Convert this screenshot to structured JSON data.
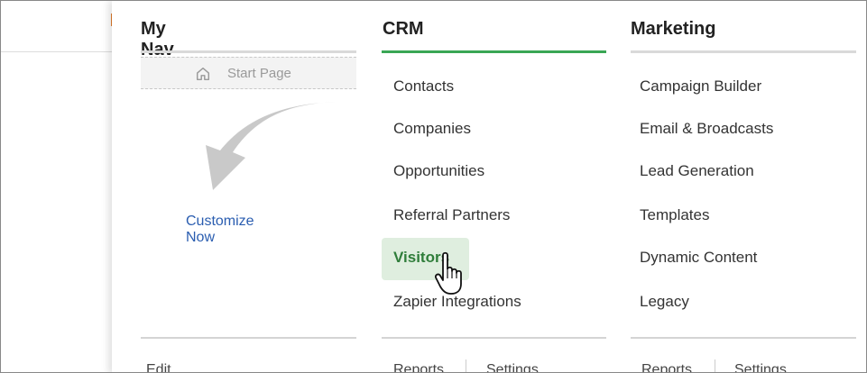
{
  "columns": {
    "mynav": {
      "title": "My Nav",
      "start_page_label": "Start Page",
      "customize_label": "Customize Now",
      "edit_label": "Edit"
    },
    "crm": {
      "title": "CRM",
      "items": [
        "Contacts",
        "Companies",
        "Opportunities",
        "Referral Partners",
        "Visitors",
        "Zapier Integrations"
      ],
      "reports_label": "Reports",
      "settings_label": "Settings"
    },
    "marketing": {
      "title": "Marketing",
      "items": [
        "Campaign Builder",
        "Email & Broadcasts",
        "Lead Generation",
        "Templates",
        "Dynamic Content",
        "Legacy"
      ],
      "reports_label": "Reports",
      "settings_label": "Settings"
    }
  },
  "colors": {
    "active_underline": "#3aa655",
    "hover_bg": "#dfeedf",
    "hover_text": "#2f7d3a",
    "link": "#2a5db0"
  },
  "icons": [
    "home-icon",
    "curved-arrow-icon",
    "hand-pointer-icon"
  ]
}
